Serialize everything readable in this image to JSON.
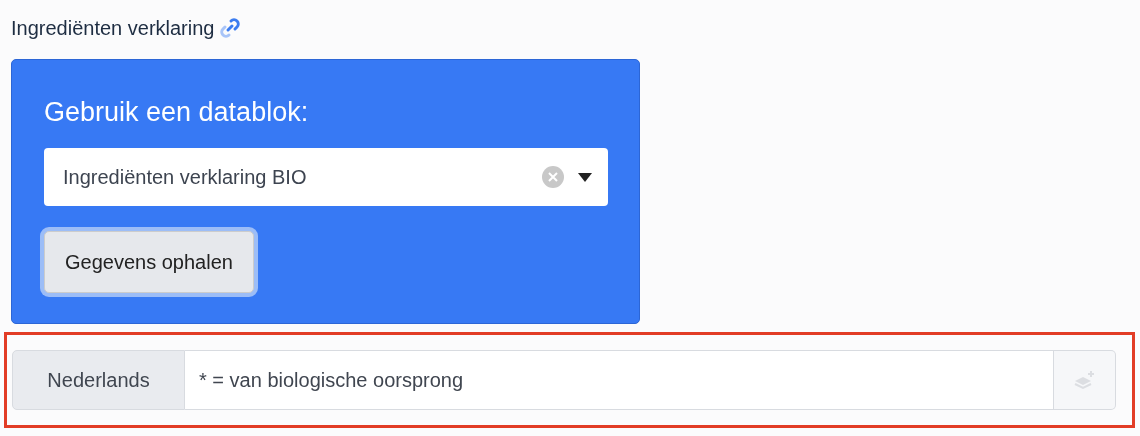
{
  "field_label": "Ingrediënten verklaring",
  "datablock": {
    "heading": "Gebruik een datablok:",
    "select_value": "Ingrediënten verklaring BIO",
    "button": "Gegevens ophalen",
    "button_focused": true
  },
  "translation": {
    "highlighted": true,
    "language": "Nederlands",
    "value": "* = van biologische oorsprong",
    "add_disabled": true
  }
}
